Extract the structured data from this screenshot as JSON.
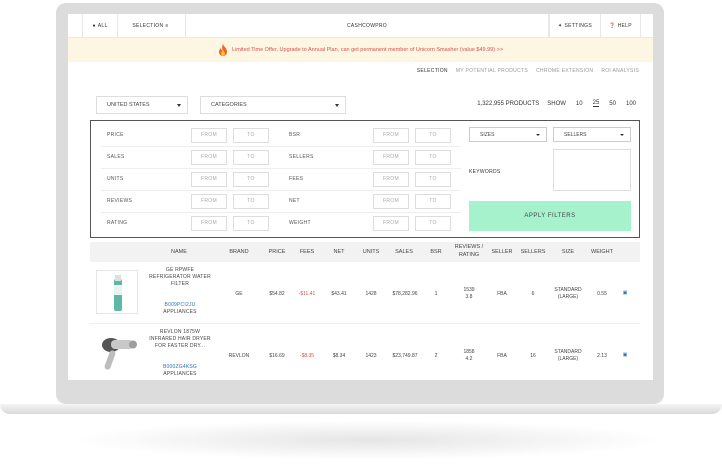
{
  "topnav": {
    "all": "ALL",
    "selection": "SELECTION",
    "brand": "CASHCOWPRO",
    "settings": "SETTINGS",
    "help": "HELP"
  },
  "promo": {
    "text": "Limited Time Offer, Upgrade to Annual Plan, can get permanent member of Unicorn Smasher (value $49.99) >>"
  },
  "subnav": {
    "items": [
      "SELECTION",
      "MY POTENTIAL PRODUCTS",
      "CHROME EXTENSION",
      "ROI ANALYSIS"
    ]
  },
  "controls": {
    "country": "UNITED STATES",
    "categories": "CATEGORIES",
    "products_count": "1,322,955 PRODUCTS",
    "show_label": "SHOW",
    "page_sizes": [
      "10",
      "25",
      "50",
      "100"
    ],
    "selected_page_size": "25"
  },
  "filters": {
    "left": [
      "PRICE",
      "SALES",
      "UNITS",
      "REVIEWS",
      "RATING"
    ],
    "middle": [
      "BSR",
      "SELLERS",
      "FEES",
      "NET",
      "WEIGHT"
    ],
    "from_placeholder": "FROM",
    "to_placeholder": "TO",
    "sizes": "SIZES",
    "sellers": "SELLERS",
    "keywords_label": "KEYWORDS",
    "apply": "APPLY FILTERS"
  },
  "table": {
    "headers": {
      "name": "NAME",
      "brand": "BRAND",
      "price": "PRICE",
      "fees": "FEES",
      "net": "NET",
      "units": "UNITS",
      "sales": "SALES",
      "bsr": "BSR",
      "reviews1": "REVIEWS /",
      "reviews2": "RATING",
      "seller": "SELLER",
      "sellers": "SELLERS",
      "size": "SIZE",
      "weight": "WEIGHT"
    },
    "rows": [
      {
        "title1": "GE RPWFE",
        "title2": "REFRIGERATOR WATER",
        "title3": "FILTER",
        "asin": "B009PCI2JU",
        "category": "APPLIANCES",
        "brand": "GE",
        "price": "$54.82",
        "fees": "-$11.41",
        "net": "$43.41",
        "units": "1428",
        "sales": "$78,282.96",
        "bsr": "1",
        "reviews": "1539",
        "rating": "3.8",
        "seller": "FBA",
        "sellers": "6",
        "size1": "STANDARD",
        "size2": "(LARGE)",
        "weight": "0.55"
      },
      {
        "title1": "REVLON 1875W",
        "title2": "INFRARED HAIR DRYER",
        "title3": "FOR FASTER DRY...",
        "asin": "B000ZG4KSG",
        "category": "APPLIANCES",
        "brand": "REVLON",
        "price": "$16.69",
        "fees": "-$8.35",
        "net": "$8.34",
        "units": "1423",
        "sales": "$23,749.87",
        "bsr": "2",
        "reviews": "1858",
        "rating": "4.2",
        "seller": "FBA",
        "sellers": "16",
        "size1": "STANDARD",
        "size2": "(LARGE)",
        "weight": "2.13"
      }
    ]
  },
  "colors": {
    "promo_text": "#d9534f",
    "apply_button": "#a6f2cd",
    "link": "#2f6fb5"
  },
  "icons": {
    "all": "user-icon",
    "selection": "list-icon",
    "settings": "wrench-icon",
    "help": "question-icon",
    "promo": "flame-icon",
    "copy": "copy-icon",
    "doc": "document-icon"
  }
}
